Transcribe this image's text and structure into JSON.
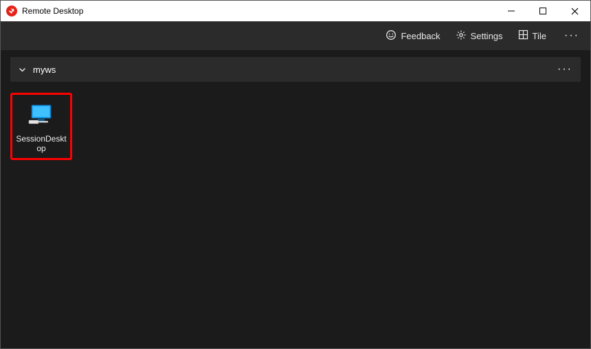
{
  "window": {
    "title": "Remote Desktop"
  },
  "toolbar": {
    "feedback_label": "Feedback",
    "settings_label": "Settings",
    "tile_label": "Tile"
  },
  "group": {
    "name": "myws"
  },
  "tiles": [
    {
      "label": "SessionDesktop"
    }
  ]
}
